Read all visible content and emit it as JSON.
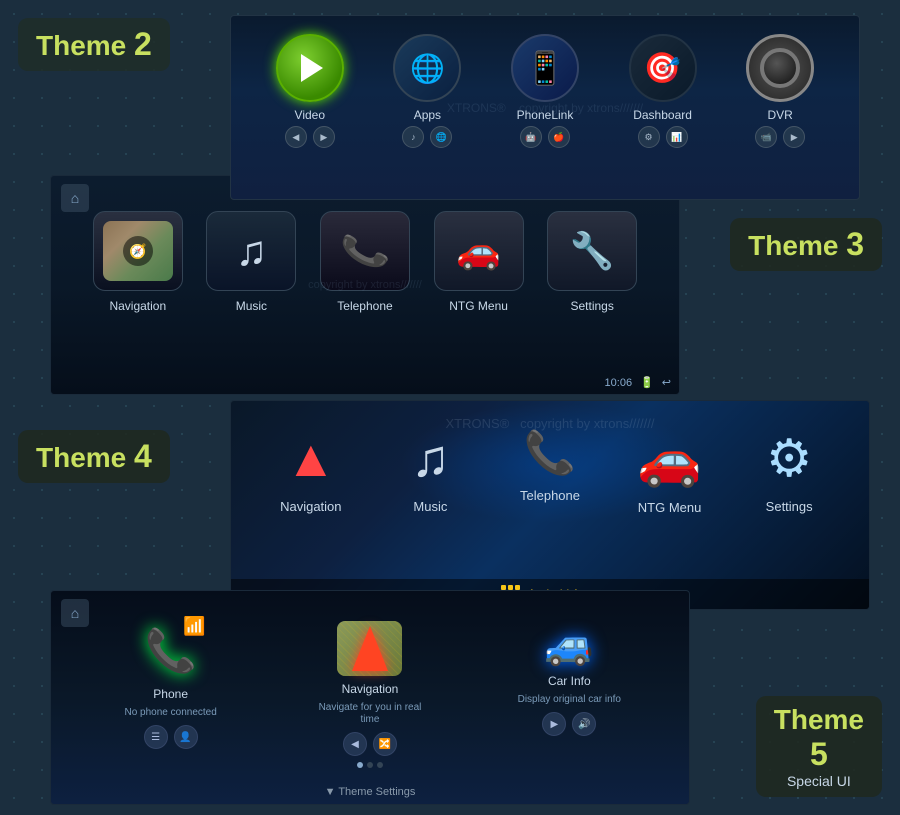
{
  "brand": "XTRONS",
  "watermark": "copyright by xtrons///////",
  "theme2": {
    "label": "Theme",
    "number": "2",
    "icons": [
      {
        "id": "video",
        "label": "Video"
      },
      {
        "id": "apps",
        "label": "Apps"
      },
      {
        "id": "phonelink",
        "label": "PhoneLink"
      },
      {
        "id": "dashboard",
        "label": "Dashboard"
      },
      {
        "id": "dvr",
        "label": "DVR"
      }
    ]
  },
  "theme3": {
    "label": "Theme",
    "number": "3",
    "icons": [
      {
        "id": "navigation",
        "label": "Navigation"
      },
      {
        "id": "music",
        "label": "Music"
      },
      {
        "id": "telephone",
        "label": "Telephone"
      },
      {
        "id": "ntg",
        "label": "NTG Menu"
      },
      {
        "id": "settings",
        "label": "Settings"
      }
    ],
    "time": "10:06"
  },
  "theme4": {
    "label": "Theme",
    "number": "4",
    "icons": [
      {
        "id": "navigation",
        "label": "Navigation"
      },
      {
        "id": "music",
        "label": "Music"
      },
      {
        "id": "telephone",
        "label": "Telephone"
      },
      {
        "id": "ntg",
        "label": "NTG Menu"
      },
      {
        "id": "settings",
        "label": "Settings"
      }
    ],
    "android_label": "Android Apps"
  },
  "theme5": {
    "label": "Theme",
    "number": "5",
    "sublabel": "Special UI",
    "icons": [
      {
        "id": "phone",
        "label": "Phone",
        "sublabel": "No phone connected"
      },
      {
        "id": "navigation",
        "label": "Navigation",
        "sublabel": "Navigate for you in real time"
      },
      {
        "id": "car-info",
        "label": "Car Info",
        "sublabel": "Display original car info"
      }
    ],
    "settings_bar": "▼  Theme Settings"
  }
}
